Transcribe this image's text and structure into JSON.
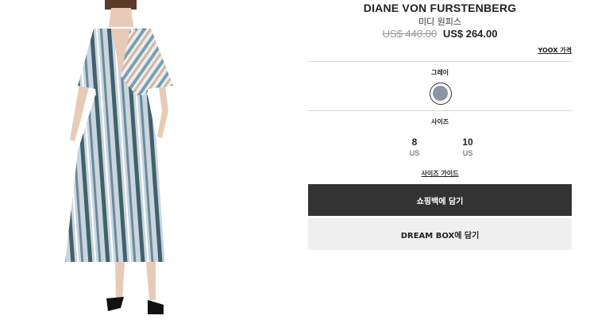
{
  "product": {
    "brand": "DIANE VON FURSTENBERG",
    "type": "미디 원피스",
    "price_original": "US$ 440.00",
    "price_sale": "US$ 264.00",
    "yoox_price_link": "YOOX 가격"
  },
  "color": {
    "label": "그레이",
    "swatch_hex": "#8a96a3"
  },
  "sizes": {
    "label": "사이즈",
    "options": [
      {
        "value": "8",
        "unit": "US"
      },
      {
        "value": "10",
        "unit": "US"
      }
    ],
    "guide_link": "사이즈 가이드"
  },
  "actions": {
    "add_to_bag": "쇼핑백에 담기",
    "add_to_dreambox": "DREAM BOX에 담기"
  },
  "image": {
    "icon": "dress-photo",
    "colors": {
      "stripe_dark": "#44606a",
      "stripe_light": "#c8d6e2",
      "stripe_accent": "#d7b49b",
      "skin": "#e8cbb6",
      "shoe": "#111111"
    }
  }
}
